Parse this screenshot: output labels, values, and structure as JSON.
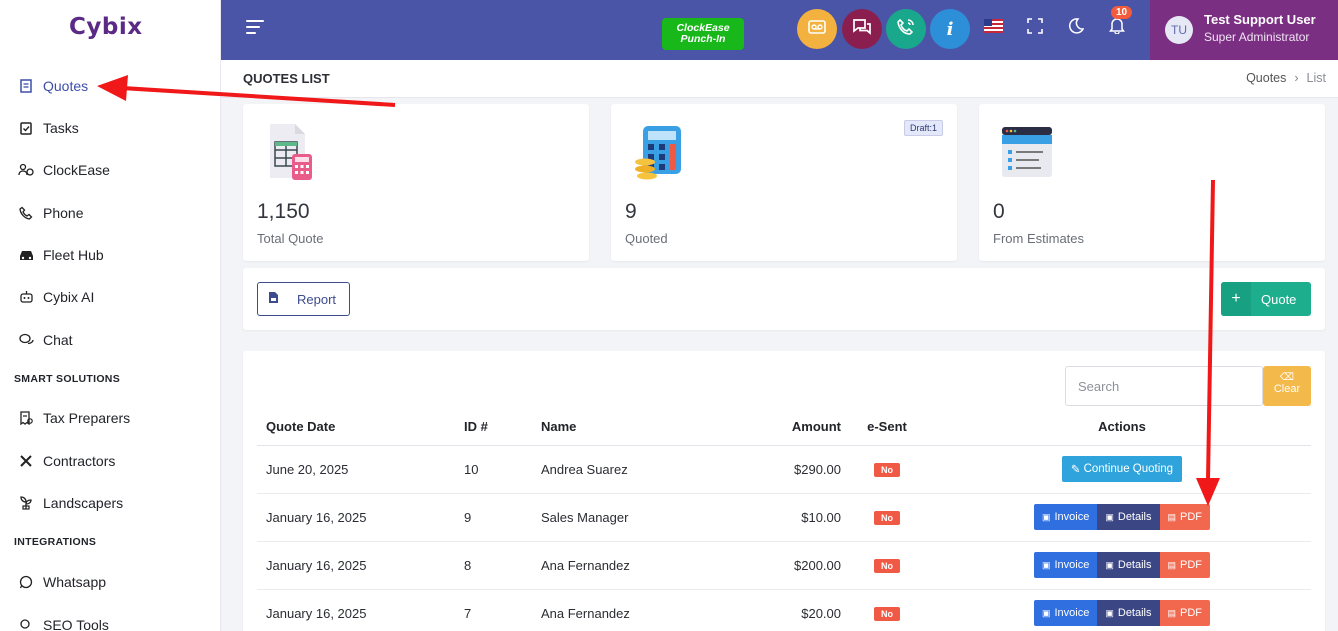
{
  "app": {
    "logo": "Cybix"
  },
  "sidebar": {
    "items": [
      {
        "label": "Quotes",
        "icon": "document-icon"
      },
      {
        "label": "Tasks",
        "icon": "clipboard-check-icon"
      },
      {
        "label": "ClockEase",
        "icon": "users-clock-icon"
      },
      {
        "label": "Phone",
        "icon": "phone-icon"
      },
      {
        "label": "Fleet Hub",
        "icon": "car-icon"
      },
      {
        "label": "Cybix AI",
        "icon": "robot-icon"
      },
      {
        "label": "Chat",
        "icon": "chat-bubbles-icon"
      }
    ],
    "section_smart": "SMART SOLUTIONS",
    "smart_items": [
      {
        "label": "Tax Preparers",
        "icon": "receipt-icon"
      },
      {
        "label": "Contractors",
        "icon": "tools-icon"
      },
      {
        "label": "Landscapers",
        "icon": "plant-icon"
      }
    ],
    "section_integrations": "INTEGRATIONS",
    "integration_items": [
      {
        "label": "Whatsapp",
        "icon": "whatsapp-icon"
      },
      {
        "label": "SEO Tools",
        "icon": "seo-icon"
      }
    ]
  },
  "topbar": {
    "punch_line1": "ClockEase",
    "punch_line2": "Punch-In",
    "notification_count": "10",
    "user_initials": "TU",
    "user_name": "Test Support User",
    "user_role": "Super Administrator",
    "colors": {
      "voicemail": "#f3b13f",
      "chat": "#8a1f4f",
      "phone": "#1aa88c",
      "info": "#2d8fd8"
    }
  },
  "page": {
    "title": "QUOTES LIST",
    "breadcrumb": [
      "Quotes",
      "List"
    ]
  },
  "stats": [
    {
      "value": "1,150",
      "label": "Total Quote"
    },
    {
      "value": "9",
      "label": "Quoted",
      "badge": "Draft:1"
    },
    {
      "value": "0",
      "label": "From Estimates"
    }
  ],
  "toolbar": {
    "report_label": "Report",
    "add_label": "Quote"
  },
  "table": {
    "search_placeholder": "Search",
    "clear_label": "Clear",
    "headers": [
      "Quote Date",
      "ID #",
      "Name",
      "Amount",
      "e-Sent",
      "Actions"
    ],
    "rows": [
      {
        "date": "June 20, 2025",
        "id": "10",
        "name": "Andrea Suarez",
        "amount": "$290.00",
        "esent": "No",
        "action": "Continue Quoting"
      },
      {
        "date": "January 16, 2025",
        "id": "9",
        "name": "Sales Manager",
        "amount": "$10.00",
        "esent": "No"
      },
      {
        "date": "January 16, 2025",
        "id": "8",
        "name": "Ana Fernandez",
        "amount": "$200.00",
        "esent": "No"
      },
      {
        "date": "January 16, 2025",
        "id": "7",
        "name": "Ana Fernandez",
        "amount": "$20.00",
        "esent": "No"
      }
    ],
    "btn_invoice": "Invoice",
    "btn_details": "Details",
    "btn_pdf": "PDF"
  }
}
